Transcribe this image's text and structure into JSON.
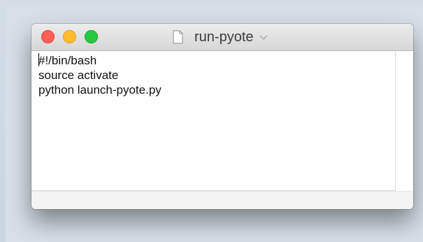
{
  "window": {
    "title": "run-pyote"
  },
  "titlebar": {
    "buttons": {
      "close_color": "#fe5f57",
      "minimize_color": "#febc2e",
      "zoom_color": "#28c840"
    },
    "icons": [
      "document-icon",
      "chevron-down-icon"
    ]
  },
  "editor": {
    "lines": [
      "#!/bin/bash",
      "source activate",
      "python launch-pyote.py"
    ]
  }
}
